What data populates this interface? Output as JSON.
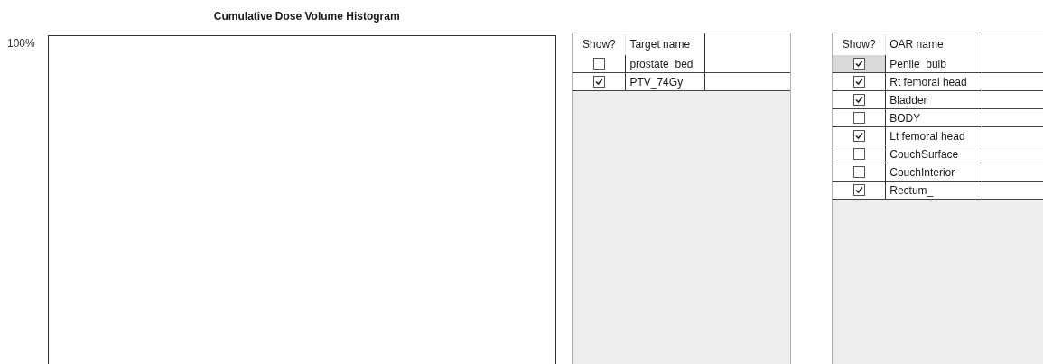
{
  "chart": {
    "title": "Cumulative Dose Volume Histogram",
    "y_tick_label": "100%"
  },
  "target_grid": {
    "columns": [
      "Show?",
      "Target name"
    ],
    "rows": [
      {
        "name": "prostate_bed",
        "checked": false
      },
      {
        "name": "PTV_74Gy",
        "checked": true
      }
    ]
  },
  "oar_grid": {
    "columns": [
      "Show?",
      "OAR name"
    ],
    "rows": [
      {
        "name": "Penile_bulb",
        "checked": true,
        "selected": true
      },
      {
        "name": "Rt femoral head",
        "checked": true,
        "selected": false
      },
      {
        "name": "Bladder",
        "checked": true,
        "selected": false
      },
      {
        "name": "BODY",
        "checked": false,
        "selected": false
      },
      {
        "name": "Lt femoral head",
        "checked": true,
        "selected": false
      },
      {
        "name": "CouchSurface",
        "checked": false,
        "selected": false
      },
      {
        "name": "CouchInterior",
        "checked": false,
        "selected": false
      },
      {
        "name": "Rectum_",
        "checked": true,
        "selected": false
      }
    ]
  }
}
